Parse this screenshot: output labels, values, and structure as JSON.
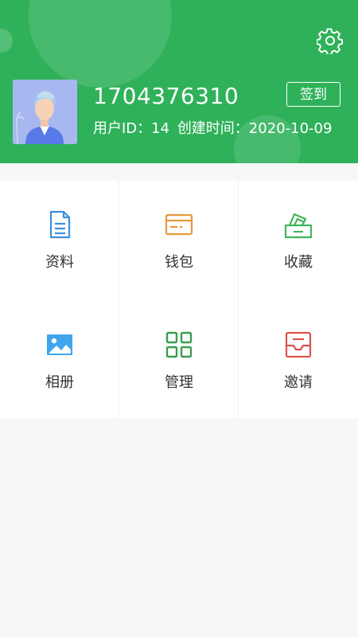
{
  "profile": {
    "username": "1704376310",
    "user_id_label": "用户ID：14",
    "created_label": "创建时间：2020-10-09",
    "signin_label": "签到"
  },
  "menu": [
    {
      "label": "资料",
      "icon": "document-icon",
      "color": "#3b8fe0"
    },
    {
      "label": "钱包",
      "icon": "wallet-icon",
      "color": "#e59a3c"
    },
    {
      "label": "收藏",
      "icon": "favorites-icon",
      "color": "#3fb55a"
    },
    {
      "label": "相册",
      "icon": "album-icon",
      "color": "#3fa6ee"
    },
    {
      "label": "管理",
      "icon": "manage-icon",
      "color": "#3a9d4e"
    },
    {
      "label": "邀请",
      "icon": "invite-icon",
      "color": "#d9534f"
    }
  ],
  "colors": {
    "header_bg": "#2fb15a",
    "page_bg": "#f7f7f7"
  }
}
